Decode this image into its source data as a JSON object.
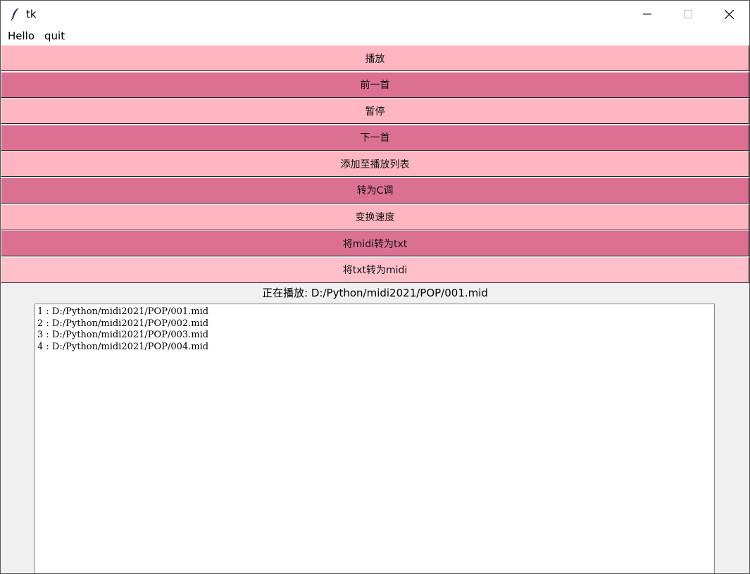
{
  "window": {
    "title": "tk"
  },
  "icons": {
    "app": "feather-icon",
    "minimize": "minimize-icon",
    "maximize": "maximize-icon",
    "close": "close-icon"
  },
  "menu": {
    "items": [
      "Hello",
      "quit"
    ]
  },
  "buttons": [
    {
      "label": "播放",
      "color": "#ffb6c1"
    },
    {
      "label": "前一首",
      "color": "#db7093"
    },
    {
      "label": "暂停",
      "color": "#ffb6c1"
    },
    {
      "label": "下一首",
      "color": "#db7093"
    },
    {
      "label": "添加至播放列表",
      "color": "#ffb6c1"
    },
    {
      "label": "转为C调",
      "color": "#db7093"
    },
    {
      "label": "变换速度",
      "color": "#ffb6c1"
    },
    {
      "label": "将midi转为txt",
      "color": "#db7093"
    },
    {
      "label": "将txt转为midi",
      "color": "#ffc0cb"
    }
  ],
  "status": {
    "text": "正在播放: D:/Python/midi2021/POP/001.mid"
  },
  "playlist": {
    "items": [
      "1 : D:/Python/midi2021/POP/001.mid",
      "2 : D:/Python/midi2021/POP/002.mid",
      "3 : D:/Python/midi2021/POP/003.mid",
      "4 : D:/Python/midi2021/POP/004.mid"
    ]
  }
}
